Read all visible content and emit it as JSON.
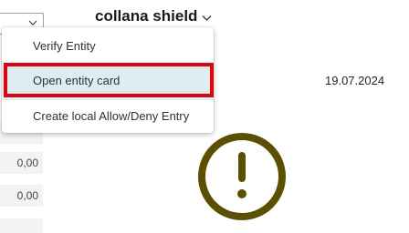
{
  "header": {
    "title": "collana shield"
  },
  "date": "19.07.2024",
  "menu": {
    "items": [
      {
        "label": "Verify Entity"
      },
      {
        "label": "Open entity card"
      },
      {
        "label": "Create local Allow/Deny Entry"
      }
    ]
  },
  "amounts": [
    "0,00",
    "0,00"
  ],
  "colors": {
    "highlight_border": "#e8000b",
    "selected_item_bg": "#ddeef2",
    "warning_icon": "#5b4f00"
  },
  "icons": {
    "header_dropdown": "chevron-down-icon",
    "field_dropdown": "chevron-down-icon",
    "status": "exclamation-circle-icon"
  }
}
